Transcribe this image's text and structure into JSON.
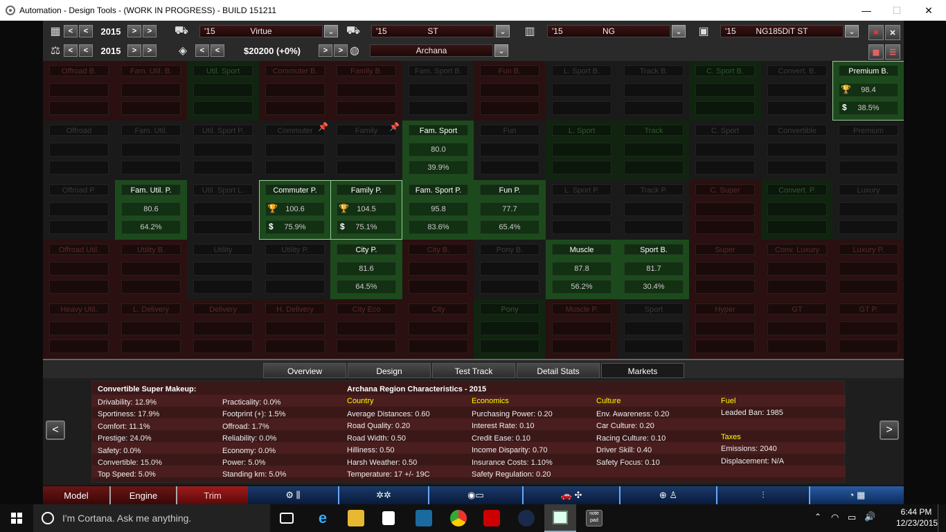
{
  "window": {
    "title": "Automation - Design Tools - (WORK IN PROGRESS) - BUILD 151211",
    "min": "—",
    "max": "☐",
    "close": "✕"
  },
  "toolbar": {
    "year1": "2015",
    "year2": "2015",
    "model_year": "'15",
    "model_name": "Virtue",
    "trim_year": "'15",
    "trim_name": "ST",
    "engine_year": "'15",
    "engine_name": "NG",
    "variant_year": "'15",
    "variant_name": "NG185DiT ST",
    "price": "$20200 (+0%)",
    "region": "Archana",
    "prev": "<",
    "next": ">"
  },
  "markets": [
    [
      {
        "n": "Offroad B.",
        "s": "r"
      },
      {
        "n": "Fam. Util. B.",
        "s": "r"
      },
      {
        "n": "Util. Sport",
        "s": "g"
      },
      {
        "n": "Commuter B.",
        "s": "r"
      },
      {
        "n": "Family B.",
        "s": "r"
      },
      {
        "n": "Fam. Sport B.",
        "s": "d"
      },
      {
        "n": "Fun B.",
        "s": "r"
      },
      {
        "n": "L. Sport B.",
        "s": "d"
      },
      {
        "n": "Track B.",
        "s": "d"
      },
      {
        "n": "C. Sport B.",
        "s": "g"
      },
      {
        "n": "Convert. B.",
        "s": "d"
      },
      {
        "n": "Premium B.",
        "s": "S",
        "score": "98.4",
        "share": "38.5%"
      }
    ],
    [
      {
        "n": "Offroad",
        "s": "d"
      },
      {
        "n": "Fam. Util.",
        "s": "d"
      },
      {
        "n": "Util. Sport P.",
        "s": "d"
      },
      {
        "n": "Commuter",
        "s": "d",
        "pin": true
      },
      {
        "n": "Family",
        "s": "d",
        "pin": true
      },
      {
        "n": "Fam. Sport",
        "s": "G",
        "score": "80.0",
        "share": "39.9%"
      },
      {
        "n": "Fun",
        "s": "d"
      },
      {
        "n": "L. Sport",
        "s": "g"
      },
      {
        "n": "Track",
        "s": "g"
      },
      {
        "n": "C. Sport",
        "s": "d"
      },
      {
        "n": "Convertible",
        "s": "d"
      },
      {
        "n": "Premium",
        "s": "d"
      }
    ],
    [
      {
        "n": "Offroad P.",
        "s": "d"
      },
      {
        "n": "Fam. Util. P.",
        "s": "G",
        "score": "80.6",
        "share": "64.2%"
      },
      {
        "n": "Util. Sport L.",
        "s": "d"
      },
      {
        "n": "Commuter P.",
        "s": "S",
        "score": "100.6",
        "share": "75.9%",
        "trophy": true
      },
      {
        "n": "Family P.",
        "s": "S",
        "score": "104.5",
        "share": "75.1%",
        "trophy": true
      },
      {
        "n": "Fam. Sport P.",
        "s": "G",
        "score": "95.8",
        "share": "83.6%"
      },
      {
        "n": "Fun P.",
        "s": "G",
        "score": "77.7",
        "share": "65.4%"
      },
      {
        "n": "L. Sport P.",
        "s": "d"
      },
      {
        "n": "Track P.",
        "s": "d"
      },
      {
        "n": "C. Super",
        "s": "r"
      },
      {
        "n": "Convert. P.",
        "s": "g"
      },
      {
        "n": "Luxury",
        "s": "d"
      }
    ],
    [
      {
        "n": "Offroad Util.",
        "s": "r"
      },
      {
        "n": "Utility B.",
        "s": "r"
      },
      {
        "n": "Utility",
        "s": "d"
      },
      {
        "n": "Utility P.",
        "s": "d"
      },
      {
        "n": "City P.",
        "s": "G",
        "score": "81.6",
        "share": "64.5%"
      },
      {
        "n": "City B.",
        "s": "r"
      },
      {
        "n": "Pony B.",
        "s": "d"
      },
      {
        "n": "Muscle",
        "s": "G",
        "score": "87.8",
        "share": "56.2%"
      },
      {
        "n": "Sport B.",
        "s": "G",
        "score": "81.7",
        "share": "30.4%"
      },
      {
        "n": "Super",
        "s": "r"
      },
      {
        "n": "Conv. Luxury",
        "s": "r"
      },
      {
        "n": "Luxury P.",
        "s": "r"
      }
    ],
    [
      {
        "n": "Heavy Util.",
        "s": "r"
      },
      {
        "n": "L. Delivery",
        "s": "r"
      },
      {
        "n": "Delivery",
        "s": "r"
      },
      {
        "n": "H. Delivery",
        "s": "r"
      },
      {
        "n": "City Eco",
        "s": "r"
      },
      {
        "n": "City",
        "s": "r"
      },
      {
        "n": "Pony",
        "s": "g"
      },
      {
        "n": "Muscle P.",
        "s": "r"
      },
      {
        "n": "Sport",
        "s": "d"
      },
      {
        "n": "Hyper",
        "s": "r"
      },
      {
        "n": "GT",
        "s": "r"
      },
      {
        "n": "GT P.",
        "s": "r"
      }
    ]
  ],
  "tabs": [
    "Overview",
    "Design",
    "Test Track",
    "Detail Stats",
    "Markets"
  ],
  "info": {
    "makeup_title": "Convertible Super Makeup:",
    "makeup_col1": [
      "Drivability: 12.9%",
      "Sportiness: 17.9%",
      "Comfort: 11.1%",
      "Prestige: 24.0%",
      "Safety: 0.0%",
      "Convertible: 15.0%",
      "Top Speed: 5.0%"
    ],
    "makeup_col2": [
      "Practicality: 0.0%",
      "Footprint (+): 1.5%",
      "Offroad: 1.7%",
      "Reliability: 0.0%",
      "Economy: 0.0%",
      "Power: 5.0%",
      "Standing km: 5.0%"
    ],
    "region_title": "Archana Region Characteristics - 2015",
    "country_h": "Country",
    "country": [
      "Average Distances: 0.60",
      "Road Quality: 0.20",
      "Road Width: 0.50",
      "Hilliness: 0.50",
      "Harsh Weather: 0.50",
      "Temperature: 17 +/- 19C"
    ],
    "economics_h": "Economics",
    "economics": [
      "Purchasing Power: 0.20",
      "Interest Rate: 0.10",
      "Credit Ease: 0.10",
      "Income Disparity: 0.70",
      "Insurance Costs: 1.10%",
      "Safety Regulation: 0.20"
    ],
    "culture_h": "Culture",
    "culture": [
      "Env. Awareness: 0.20",
      "Car Culture: 0.20",
      "Racing Culture: 0.10",
      "Driver Skill: 0.40",
      "Safety Focus: 0.10"
    ],
    "fuel_h": "Fuel",
    "fuel": "Leaded Ban: 1985",
    "taxes_h": "Taxes",
    "emissions": "Emissions: 2040",
    "displacement": "Displacement: N/A"
  },
  "bottom": {
    "model": "Model",
    "engine": "Engine",
    "trim": "Trim"
  },
  "taskbar": {
    "cortana": "I'm Cortana. Ask me anything.",
    "time": "6:44 PM",
    "date": "12/23/2015"
  }
}
